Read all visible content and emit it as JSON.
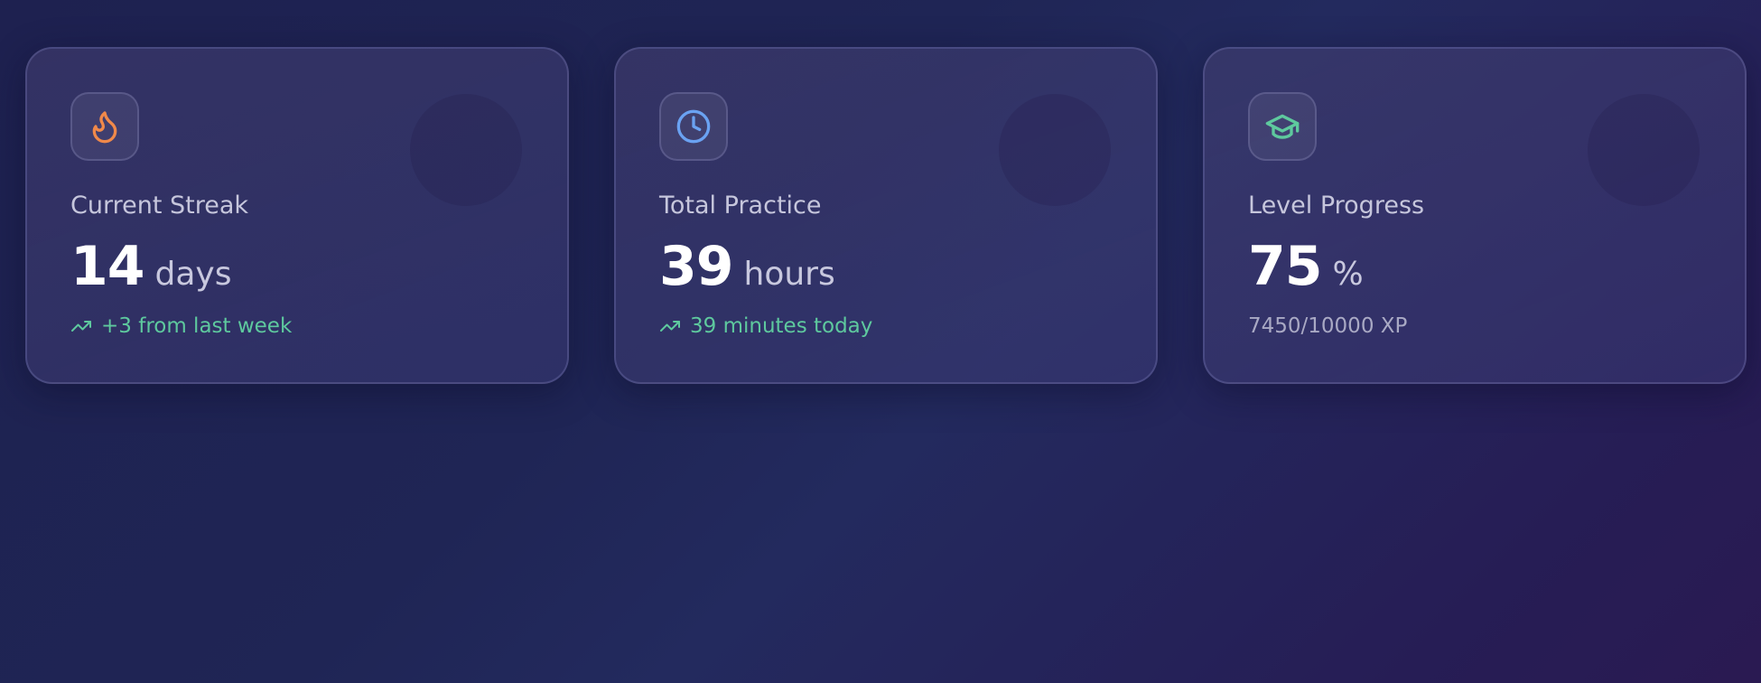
{
  "colors": {
    "streak_icon": "#f0894a",
    "practice_icon": "#6aa2f2",
    "level_icon": "#5ec99e",
    "trend_text": "#5ec99e"
  },
  "cards": [
    {
      "icon": "flame-icon",
      "label": "Current Streak",
      "value": "14",
      "unit": "days",
      "footer": "+3 from last week",
      "footer_icon": "trending-up-icon"
    },
    {
      "icon": "clock-icon",
      "label": "Total Practice",
      "value": "39",
      "unit": "hours",
      "footer": "39 minutes today",
      "footer_icon": "trending-up-icon"
    },
    {
      "icon": "graduation-cap-icon",
      "label": "Level Progress",
      "value": "75",
      "unit": "%",
      "footer": "7450/10000 XP"
    }
  ]
}
